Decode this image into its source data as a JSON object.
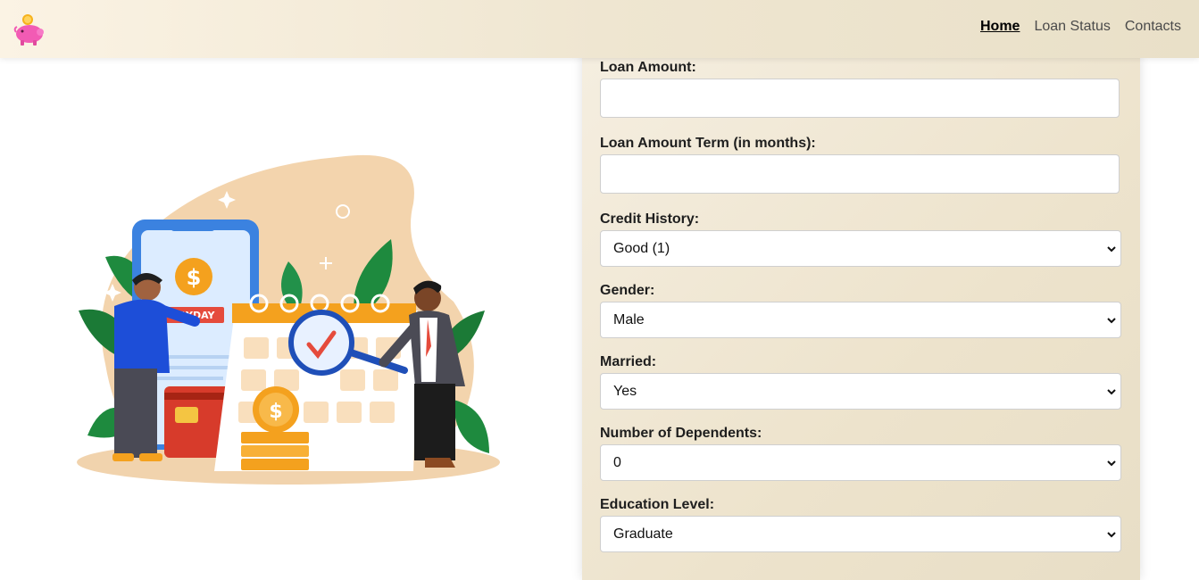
{
  "nav": {
    "links": [
      {
        "label": "Home",
        "active": true
      },
      {
        "label": "Loan Status",
        "active": false
      },
      {
        "label": "Contacts",
        "active": false
      }
    ]
  },
  "illustration": {
    "payday_label": "PAYDAY",
    "dollar_symbol": "$"
  },
  "form": {
    "loan_amount": {
      "label": "Loan Amount:",
      "value": ""
    },
    "loan_term": {
      "label": "Loan Amount Term (in months):",
      "value": ""
    },
    "credit_history": {
      "label": "Credit History:",
      "selected": "Good (1)"
    },
    "gender": {
      "label": "Gender:",
      "selected": "Male"
    },
    "married": {
      "label": "Married:",
      "selected": "Yes"
    },
    "dependents": {
      "label": "Number of Dependents:",
      "selected": "0"
    },
    "education": {
      "label": "Education Level:",
      "selected": "Graduate"
    }
  },
  "colors": {
    "navbar_bg": "#f3ead8",
    "form_bg": "#efe6d1",
    "illustration_blob": "#f3d4ad",
    "accent_orange": "#f4a11e",
    "phone_blue": "#3b82e0",
    "card_red": "#d73b2b",
    "leaf_green": "#1e8a3e",
    "logo_pink": "#f25bb4"
  }
}
